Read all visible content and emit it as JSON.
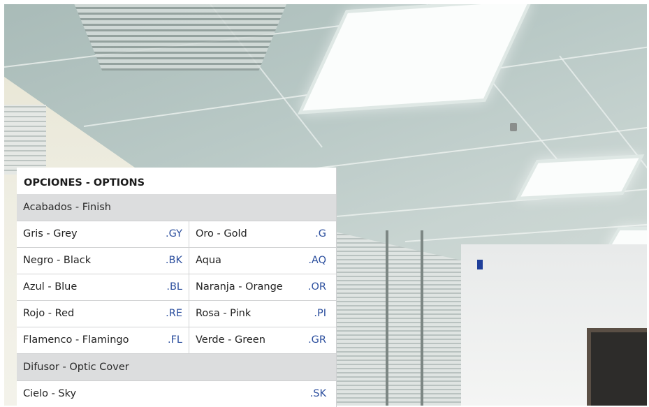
{
  "options_table": {
    "title": "OPCIONES - OPTIONS",
    "finish_section": "Acabados - Finish",
    "finish_rows": [
      {
        "left_label": "Gris - Grey",
        "left_code": ".GY",
        "right_label": "Oro - Gold",
        "right_code": ".G"
      },
      {
        "left_label": "Negro - Black",
        "left_code": ".BK",
        "right_label": "Aqua",
        "right_code": ".AQ"
      },
      {
        "left_label": "Azul - Blue",
        "left_code": ".BL",
        "right_label": "Naranja - Orange",
        "right_code": ".OR"
      },
      {
        "left_label": "Rojo - Red",
        "left_code": ".RE",
        "right_label": "Rosa - Pink",
        "right_code": ".PI"
      },
      {
        "left_label": "Flamenco - Flamingo",
        "left_code": ".FL",
        "right_label": "Verde - Green",
        "right_code": ".GR"
      }
    ],
    "diffuser_section": "Difusor - Optic Cover",
    "diffuser_rows": [
      {
        "label": "Cielo - Sky",
        "code": ".SK"
      }
    ]
  },
  "colors": {
    "code_text": "#2c4f9e",
    "section_background": "#dcddde",
    "table_background": "#ffffff"
  }
}
